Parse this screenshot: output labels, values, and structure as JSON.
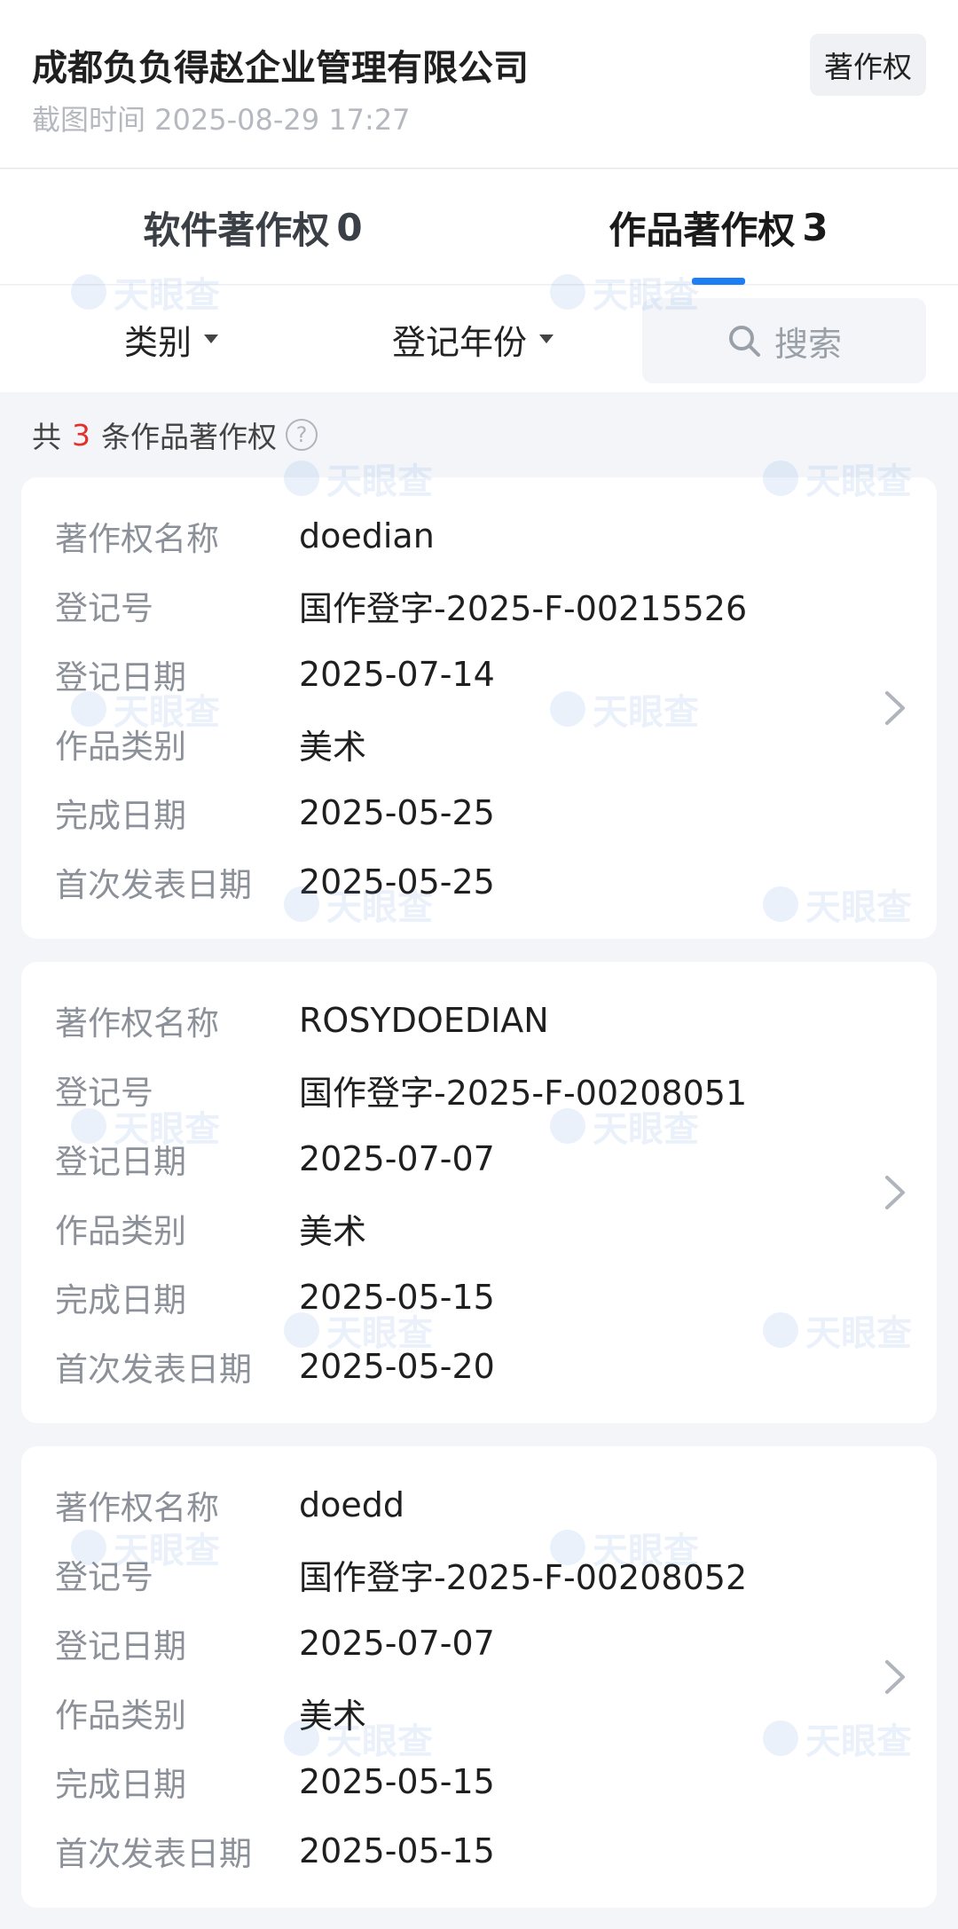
{
  "header": {
    "company_name": "成都负负得赵企业管理有限公司",
    "screenshot_time": "截图时间 2025-08-29 17:27",
    "tag": "著作权"
  },
  "tabs": [
    {
      "label": "软件著作权",
      "count": "0",
      "active": false
    },
    {
      "label": "作品著作权",
      "count": "3",
      "active": true
    }
  ],
  "filters": {
    "category": "类别",
    "year": "登记年份",
    "search": "搜索"
  },
  "summary": {
    "prefix": "共",
    "count": "3",
    "suffix": "条作品著作权"
  },
  "watermark": "天眼查",
  "accent_color": "#1c7ef5",
  "records": [
    {
      "rows": [
        {
          "label": "著作权名称",
          "value": "doedian"
        },
        {
          "label": "登记号",
          "value": "国作登字-2025-F-00215526"
        },
        {
          "label": "登记日期",
          "value": "2025-07-14"
        },
        {
          "label": "作品类别",
          "value": "美术"
        },
        {
          "label": "完成日期",
          "value": "2025-05-25"
        },
        {
          "label": "首次发表日期",
          "value": "2025-05-25"
        }
      ]
    },
    {
      "rows": [
        {
          "label": "著作权名称",
          "value": "ROSYDOEDIAN"
        },
        {
          "label": "登记号",
          "value": "国作登字-2025-F-00208051"
        },
        {
          "label": "登记日期",
          "value": "2025-07-07"
        },
        {
          "label": "作品类别",
          "value": "美术"
        },
        {
          "label": "完成日期",
          "value": "2025-05-15"
        },
        {
          "label": "首次发表日期",
          "value": "2025-05-20"
        }
      ]
    },
    {
      "rows": [
        {
          "label": "著作权名称",
          "value": "doedd"
        },
        {
          "label": "登记号",
          "value": "国作登字-2025-F-00208052"
        },
        {
          "label": "登记日期",
          "value": "2025-07-07"
        },
        {
          "label": "作品类别",
          "value": "美术"
        },
        {
          "label": "完成日期",
          "value": "2025-05-15"
        },
        {
          "label": "首次发表日期",
          "value": "2025-05-15"
        }
      ]
    }
  ]
}
